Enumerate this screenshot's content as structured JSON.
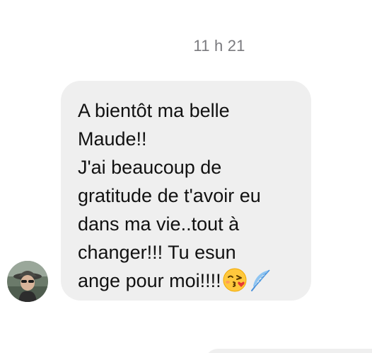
{
  "conversation": {
    "timestamp": "11 h 21",
    "message": {
      "text": "A bientôt ma belle\nMaude!!\nJ'ai beaucoup de\ngratitude de t'avoir eu\ndans ma vie..tout à\nchanger!!! Tu esun\nange pour moi!!!!",
      "emojis": [
        "face-blowing-kiss-icon",
        "feather-icon"
      ],
      "bubble_color": "#efefef",
      "text_color": "#111111"
    },
    "sender": {
      "avatar": "sender-avatar"
    }
  }
}
